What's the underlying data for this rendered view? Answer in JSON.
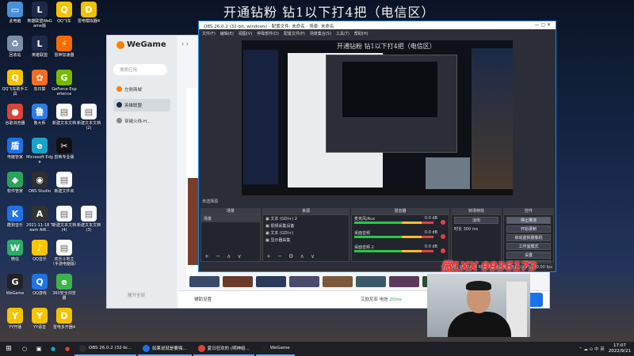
{
  "stream_title": "开通钻粉 钻1以下打4把（电信区）",
  "desktop_icons": [
    {
      "label": "此电脑",
      "color": "#4a90d9",
      "glyph": "▭",
      "col": 0,
      "row": 0
    },
    {
      "label": "英雄联盟WeGame版",
      "color": "#1e2a4a",
      "glyph": "L",
      "col": 1,
      "row": 0
    },
    {
      "label": "QQ飞车",
      "color": "#f5c400",
      "glyph": "Q",
      "col": 2,
      "row": 0
    },
    {
      "label": "雷电模拟器4",
      "color": "#f2c200",
      "glyph": "D",
      "col": 3,
      "row": 0
    },
    {
      "label": "回收站",
      "color": "#7a8ea6",
      "glyph": "♻",
      "col": 0,
      "row": 1
    },
    {
      "label": "英雄联盟",
      "color": "#1e2a4a",
      "glyph": "L",
      "col": 1,
      "row": 1
    },
    {
      "label": "雷神加速器",
      "color": "#f56b00",
      "glyph": "⚡",
      "col": 2,
      "row": 1
    },
    {
      "label": "QQ飞车助手工具",
      "color": "#f5c400",
      "glyph": "Q",
      "col": 0,
      "row": 2
    },
    {
      "label": "向日葵",
      "color": "#f26d21",
      "glyph": "✿",
      "col": 1,
      "row": 2
    },
    {
      "label": "GeForce Experience",
      "color": "#76b900",
      "glyph": "G",
      "col": 2,
      "row": 2
    },
    {
      "label": "谷歌浏览器",
      "color": "#db4437",
      "glyph": "●",
      "col": 0,
      "row": 3
    },
    {
      "label": "鲁大师",
      "color": "#2b7de9",
      "glyph": "鲁",
      "col": 1,
      "row": 3
    },
    {
      "label": "新建文本文档",
      "color": "#ffffff",
      "glyph": "▤",
      "col": 2,
      "row": 3
    },
    {
      "label": "新建文本文档 (2)",
      "color": "#ffffff",
      "glyph": "▤",
      "col": 3,
      "row": 3
    },
    {
      "label": "电脑管家",
      "color": "#1f6fe5",
      "glyph": "盾",
      "col": 0,
      "row": 4
    },
    {
      "label": "Microsoft Edge",
      "color": "#1aa3c8",
      "glyph": "e",
      "col": 1,
      "row": 4
    },
    {
      "label": "剪映专业版",
      "color": "#111111",
      "glyph": "✂",
      "col": 2,
      "row": 4
    },
    {
      "label": "软件管家",
      "color": "#29a35a",
      "glyph": "◆",
      "col": 0,
      "row": 5
    },
    {
      "label": "OBS Studio",
      "color": "#302e31",
      "glyph": "◉",
      "col": 1,
      "row": 5
    },
    {
      "label": "新建文件夹",
      "color": "#ffffff",
      "glyph": "▤",
      "col": 2,
      "row": 5
    },
    {
      "label": "酷狗音乐",
      "color": "#1f73e8",
      "glyph": "K",
      "col": 0,
      "row": 6
    },
    {
      "label": "2021-11-18 Team AIR...",
      "color": "#333333",
      "glyph": "A",
      "col": 1,
      "row": 6
    },
    {
      "label": "新建文本文档 (4)",
      "color": "#ffffff",
      "glyph": "▤",
      "col": 2,
      "row": 6
    },
    {
      "label": "新建文本文档 (3)",
      "color": "#ffffff",
      "glyph": "▤",
      "col": 3,
      "row": 6
    },
    {
      "label": "微信",
      "color": "#2aae67",
      "glyph": "W",
      "col": 0,
      "row": 7
    },
    {
      "label": "QQ音乐",
      "color": "#f9c600",
      "glyph": "♪",
      "col": 1,
      "row": 7
    },
    {
      "label": "欢乐斗地主（手游电脑版）",
      "color": "#ffffff",
      "glyph": "▤",
      "col": 2,
      "row": 7
    },
    {
      "label": "WeGame",
      "color": "#222222",
      "glyph": "G",
      "col": 0,
      "row": 8
    },
    {
      "label": "QQ游戏",
      "color": "#1f73e8",
      "glyph": "Q",
      "col": 1,
      "row": 8
    },
    {
      "label": "360安全浏览器",
      "color": "#3ab54a",
      "glyph": "e",
      "col": 2,
      "row": 8
    },
    {
      "label": "YY开播",
      "color": "#f5c400",
      "glyph": "Y",
      "col": 0,
      "row": 9
    },
    {
      "label": "YY语音",
      "color": "#f5c400",
      "glyph": "Y",
      "col": 1,
      "row": 9
    },
    {
      "label": "雷电多开器4",
      "color": "#f2c200",
      "glyph": "D",
      "col": 2,
      "row": 9
    }
  ],
  "wegame": {
    "logo": "WeGame",
    "nav_arrows": "‹ ›",
    "search_placeholder": "搜索应用",
    "side_items": [
      {
        "label": "左侧商城",
        "color": "#ff7d00",
        "selected": false
      },
      {
        "label": "英雄联盟",
        "color": "#1e2a4a",
        "selected": true
      },
      {
        "label": "穿越火线-H...",
        "color": "#8a8a8a",
        "selected": false
      }
    ],
    "bottom_left": "展开全部",
    "footer_assist": "辅助设置",
    "footer_region": "艾欧尼亚 电信",
    "footer_ping": "20ms"
  },
  "obs": {
    "title": "OBS 26.0.2 (32-bit, windows) - 配置文件: 未命名 - 场景: 未命名",
    "window_controls": "—   ▢   ✕",
    "menu": [
      "文件(F)",
      "编辑(E)",
      "视图(V)",
      "停靠部件(D)",
      "配置文件(P)",
      "场景集合(S)",
      "工具(T)",
      "帮助(H)"
    ],
    "preview_title": "开通钻粉 钻1以下打4把（电信区）",
    "no_source_selected": "未选择源",
    "docks": {
      "scenes": {
        "header": "场景",
        "items": [
          "场景"
        ]
      },
      "sources": {
        "header": "来源",
        "items": [
          "文本 (GDI+) 2",
          "视频采集设备",
          "文本 (GDI+)",
          "显示器采集"
        ]
      },
      "mixer": {
        "header": "混音器",
        "channels": [
          {
            "name": "麦克风/Aux",
            "db": "0.0 dB"
          },
          {
            "name": "桌面音频",
            "db": "0.0 dB"
          },
          {
            "name": "桌面音频 2",
            "db": "0.0 dB"
          }
        ]
      },
      "transitions": {
        "header": "转场特效",
        "type": "淡出",
        "duration_label": "时长",
        "duration": "300 ms"
      },
      "controls": {
        "header": "控件",
        "buttons": [
          "停止推流",
          "开始录制",
          "启动虚拟摄像机",
          "工作室模式",
          "设置",
          "退出"
        ]
      }
    },
    "status": "LIVE: 00:00:00  REC: 00:00:00  CPU: 10.4%, 60.00 fps"
  },
  "watermark": "微1XX 9936173",
  "taskbar": {
    "apps": [
      {
        "label": "OBS 26.0.2 (32-bi...",
        "color": "#302e31"
      },
      {
        "label": "如果说就是要嗨...",
        "color": "#1f73e8"
      },
      {
        "label": "夏日狂欢的 (明神组...",
        "color": "#db4437"
      },
      {
        "label": "WeGame",
        "color": "#222222"
      }
    ],
    "tray_icons": "⌃  ☁  ⊙  中  英",
    "time": "17:07",
    "date": "2022/9/21"
  }
}
